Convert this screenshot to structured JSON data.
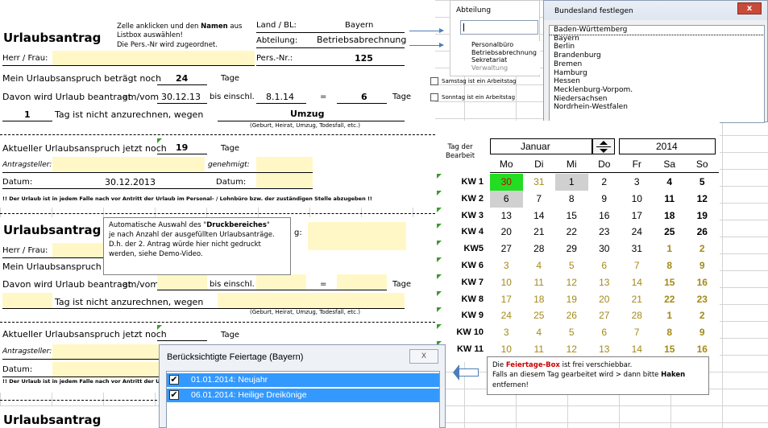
{
  "form1": {
    "instruction_line1": "Zelle anklicken und den",
    "instruction_bold": "Namen",
    "instruction_line1b": "aus",
    "instruction_line2": "Listbox auswählen!",
    "instruction_line3": "Die Pers.-Nr wird zugeordnet.",
    "title": "Urlaubsantrag",
    "land_label": "Land / BL:",
    "land_value": "Bayern",
    "abteilung_label": "Abteilung:",
    "abteilung_value": "Betriebsabrechnung",
    "herr_frau": "Herr / Frau:",
    "persnr_label": "Pers.-Nr.:",
    "persnr_value": "125",
    "anspruch_label": "Mein Urlaubsanspruch beträgt noch",
    "anspruch_value": "24",
    "tage1": "Tage",
    "davon_label": "Davon wird Urlaub beantragt",
    "amvom": "am/vom",
    "from_date": "30.12.13",
    "bis_label": "bis einschl.",
    "to_date": "8.1.14",
    "equals": "=",
    "days_value": "6",
    "tage2": "Tage",
    "not_count_value": "1",
    "not_count_label": "Tag ist nicht anzurechnen, wegen",
    "reason_value": "Umzug",
    "reason_hint": "(Geburt, Heirat, Umzug, Todesfall, etc.)",
    "aktuell_label": "Aktueller Urlaubsanspruch jetzt noch",
    "aktuell_value": "19",
    "tage3": "Tage",
    "antragsteller": "Antragsteller:",
    "genehmigt": "genehmigt:",
    "datum1": "Datum:",
    "datum_value": "30.12.2013",
    "datum2": "Datum:",
    "footer": "!! Der Urlaub ist in jedem Falle nach vor Antritt der Urlaub im Personal- / Lohnbüro bzw. der zuständigen Stelle abzugeben !!"
  },
  "form2": {
    "title": "Urlaubsantrag",
    "land_label_partial": "g:",
    "herr_frau": "Herr / Frau:",
    "anspruch_label": "Mein Urlaubsanspruch be",
    "davon_label": "Davon wird Urlaub beantragt",
    "amvom": "am/vom",
    "bis_label": "bis einschl.",
    "equals": "=",
    "tage2": "Tage",
    "not_count_label": "Tag ist nicht anzurechnen, wegen",
    "reason_hint": "(Geburt, Heirat, Umzug, Todesfall, etc.)",
    "aktuell_label": "Aktueller Urlaubsanspruch jetzt noch",
    "tage3": "Tage",
    "antragsteller": "Antragsteller:",
    "datum1": "Datum:",
    "footer": "!! Der Urlaub ist in jedem Falle nach vor Antritt der Urla"
  },
  "form3": {
    "title": "Urlaubsantrag"
  },
  "print_note": {
    "line1a": "Automatische Auswahl des \"",
    "line1b": "Druckbereiches",
    "line1c": "\"",
    "line2": "je nach Anzahl der ausgefüllten Urlaubsanträge.",
    "line3": "D.h. der 2. Antrag würde hier nicht gedruckt",
    "line4": "werden, siehe Demo-Video."
  },
  "abteilung_panel": {
    "label": "Abteilung",
    "items": [
      "Personalbüro",
      "Betriebsabrechnung",
      "Sekretariat",
      "Verwaltung"
    ]
  },
  "bundesland_panel": {
    "title": "Bundesland festlegen",
    "close": "x",
    "items": [
      "Baden-Württemberg",
      "Bayern",
      "Berlin",
      "Brandenburg",
      "Bremen",
      "Hamburg",
      "Hessen",
      "Mecklenburg-Vorpom.",
      "Niedersachsen",
      "Nordrhein-Westfalen"
    ]
  },
  "checkboxes": {
    "samstag": "Samstag ist ein Arbeitstag",
    "sonntag": "Sonntag ist ein Arbeitstag"
  },
  "calendar": {
    "tag_der": "Tag der",
    "bearbeit": "Bearbeit",
    "month": "Januar",
    "year": "2014",
    "weekdays": [
      "Mo",
      "Di",
      "Mi",
      "Do",
      "Fr",
      "Sa",
      "So"
    ],
    "weeks": [
      {
        "kw": "KW 1",
        "days": [
          "30",
          "31",
          "1",
          "2",
          "3",
          "4",
          "5"
        ]
      },
      {
        "kw": "KW 2",
        "days": [
          "6",
          "7",
          "8",
          "9",
          "10",
          "11",
          "12"
        ]
      },
      {
        "kw": "KW 3",
        "days": [
          "13",
          "14",
          "15",
          "16",
          "17",
          "18",
          "19"
        ]
      },
      {
        "kw": "KW 4",
        "days": [
          "20",
          "21",
          "22",
          "23",
          "24",
          "25",
          "26"
        ]
      },
      {
        "kw": "KW5",
        "days": [
          "27",
          "28",
          "29",
          "30",
          "31",
          "1",
          "2"
        ]
      },
      {
        "kw": "KW 6",
        "days": [
          "3",
          "4",
          "5",
          "6",
          "7",
          "8",
          "9"
        ]
      },
      {
        "kw": "KW 7",
        "days": [
          "10",
          "11",
          "12",
          "13",
          "14",
          "15",
          "16"
        ]
      },
      {
        "kw": "KW 8",
        "days": [
          "17",
          "18",
          "19",
          "20",
          "21",
          "22",
          "23"
        ]
      },
      {
        "kw": "KW 9",
        "days": [
          "24",
          "25",
          "26",
          "27",
          "28",
          "1",
          "2"
        ]
      },
      {
        "kw": "KW 10",
        "days": [
          "3",
          "4",
          "5",
          "6",
          "7",
          "8",
          "9"
        ]
      },
      {
        "kw": "KW 11",
        "days": [
          "10",
          "11",
          "12",
          "13",
          "14",
          "15",
          "16"
        ]
      }
    ]
  },
  "feiertage_dialog": {
    "title": "Berücksichtigte Feiertage (Bayern)",
    "close": "X",
    "items": [
      "01.01.2014: Neujahr",
      "06.01.2014: Heilige Dreikönige"
    ]
  },
  "feiertage_note": {
    "line1a": "Die ",
    "line1b": "Feiertage-Box",
    "line1c": " ist frei verschiebbar.",
    "line2a": "Falls an diesem Tag gearbeitet wird  > dann bitte ",
    "line2b": "Haken",
    "line3": "entfernen!"
  },
  "colors": {
    "highlight_green": "#22dd22",
    "today_gray": "#d0d0d0",
    "selection_blue": "#3399ff",
    "olive_text": "#a48a18",
    "red_text": "#cc0000"
  }
}
